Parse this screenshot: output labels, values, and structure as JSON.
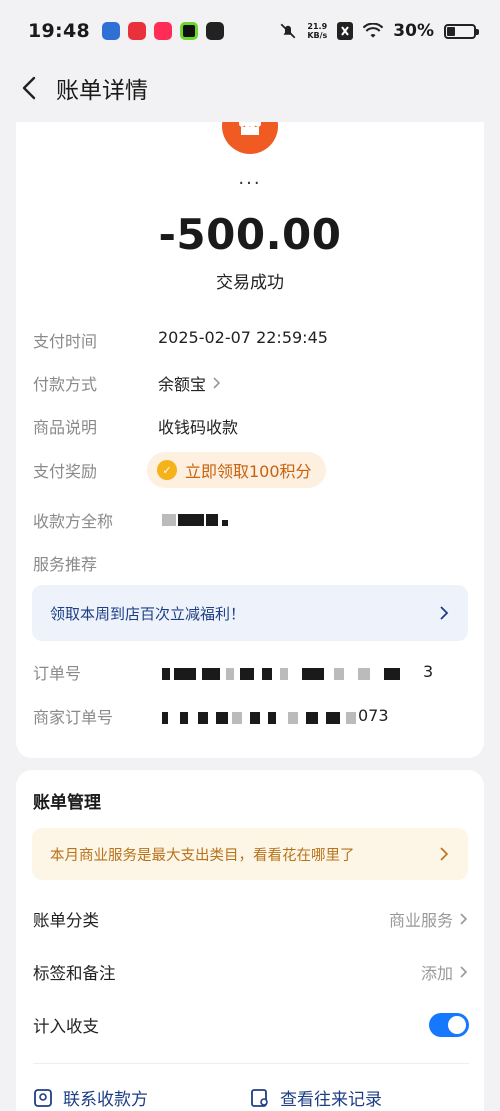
{
  "status_bar": {
    "time": "19:48",
    "speed_top": "21.9",
    "speed_bottom": "KB/s",
    "battery": "30%",
    "battery_level": 0.3
  },
  "nav": {
    "title": "账单详情"
  },
  "transaction": {
    "merchant_name": "...",
    "amount": "-500.00",
    "status": "交易成功"
  },
  "details": {
    "pay_time_label": "支付时间",
    "pay_time": "2025-02-07 22:59:45",
    "pay_method_label": "付款方式",
    "pay_method": "余额宝",
    "desc_label": "商品说明",
    "desc": "收钱码收款",
    "reward_label": "支付奖励",
    "reward": "立即领取100积分",
    "payee_label": "收款方全称",
    "service_label": "服务推荐",
    "promo": "领取本周到店百次立减福利！",
    "order_no_label": "订单号",
    "order_no_tail": "3",
    "merchant_order_label": "商家订单号",
    "merchant_order_tail": "073"
  },
  "management": {
    "title": "账单管理",
    "tip": "本月商业服务是最大支出类目，看看花在哪里了",
    "category_label": "账单分类",
    "category_value": "商业服务",
    "tags_label": "标签和备注",
    "tags_value": "添加",
    "include_label": "计入收支",
    "include_on": true,
    "contact_payee": "联系收款方",
    "view_records": "查看往来记录"
  },
  "colors": {
    "accent_blue": "#1677ff",
    "merchant_orange": "#f05a23",
    "reward_orange": "#c8620d"
  }
}
